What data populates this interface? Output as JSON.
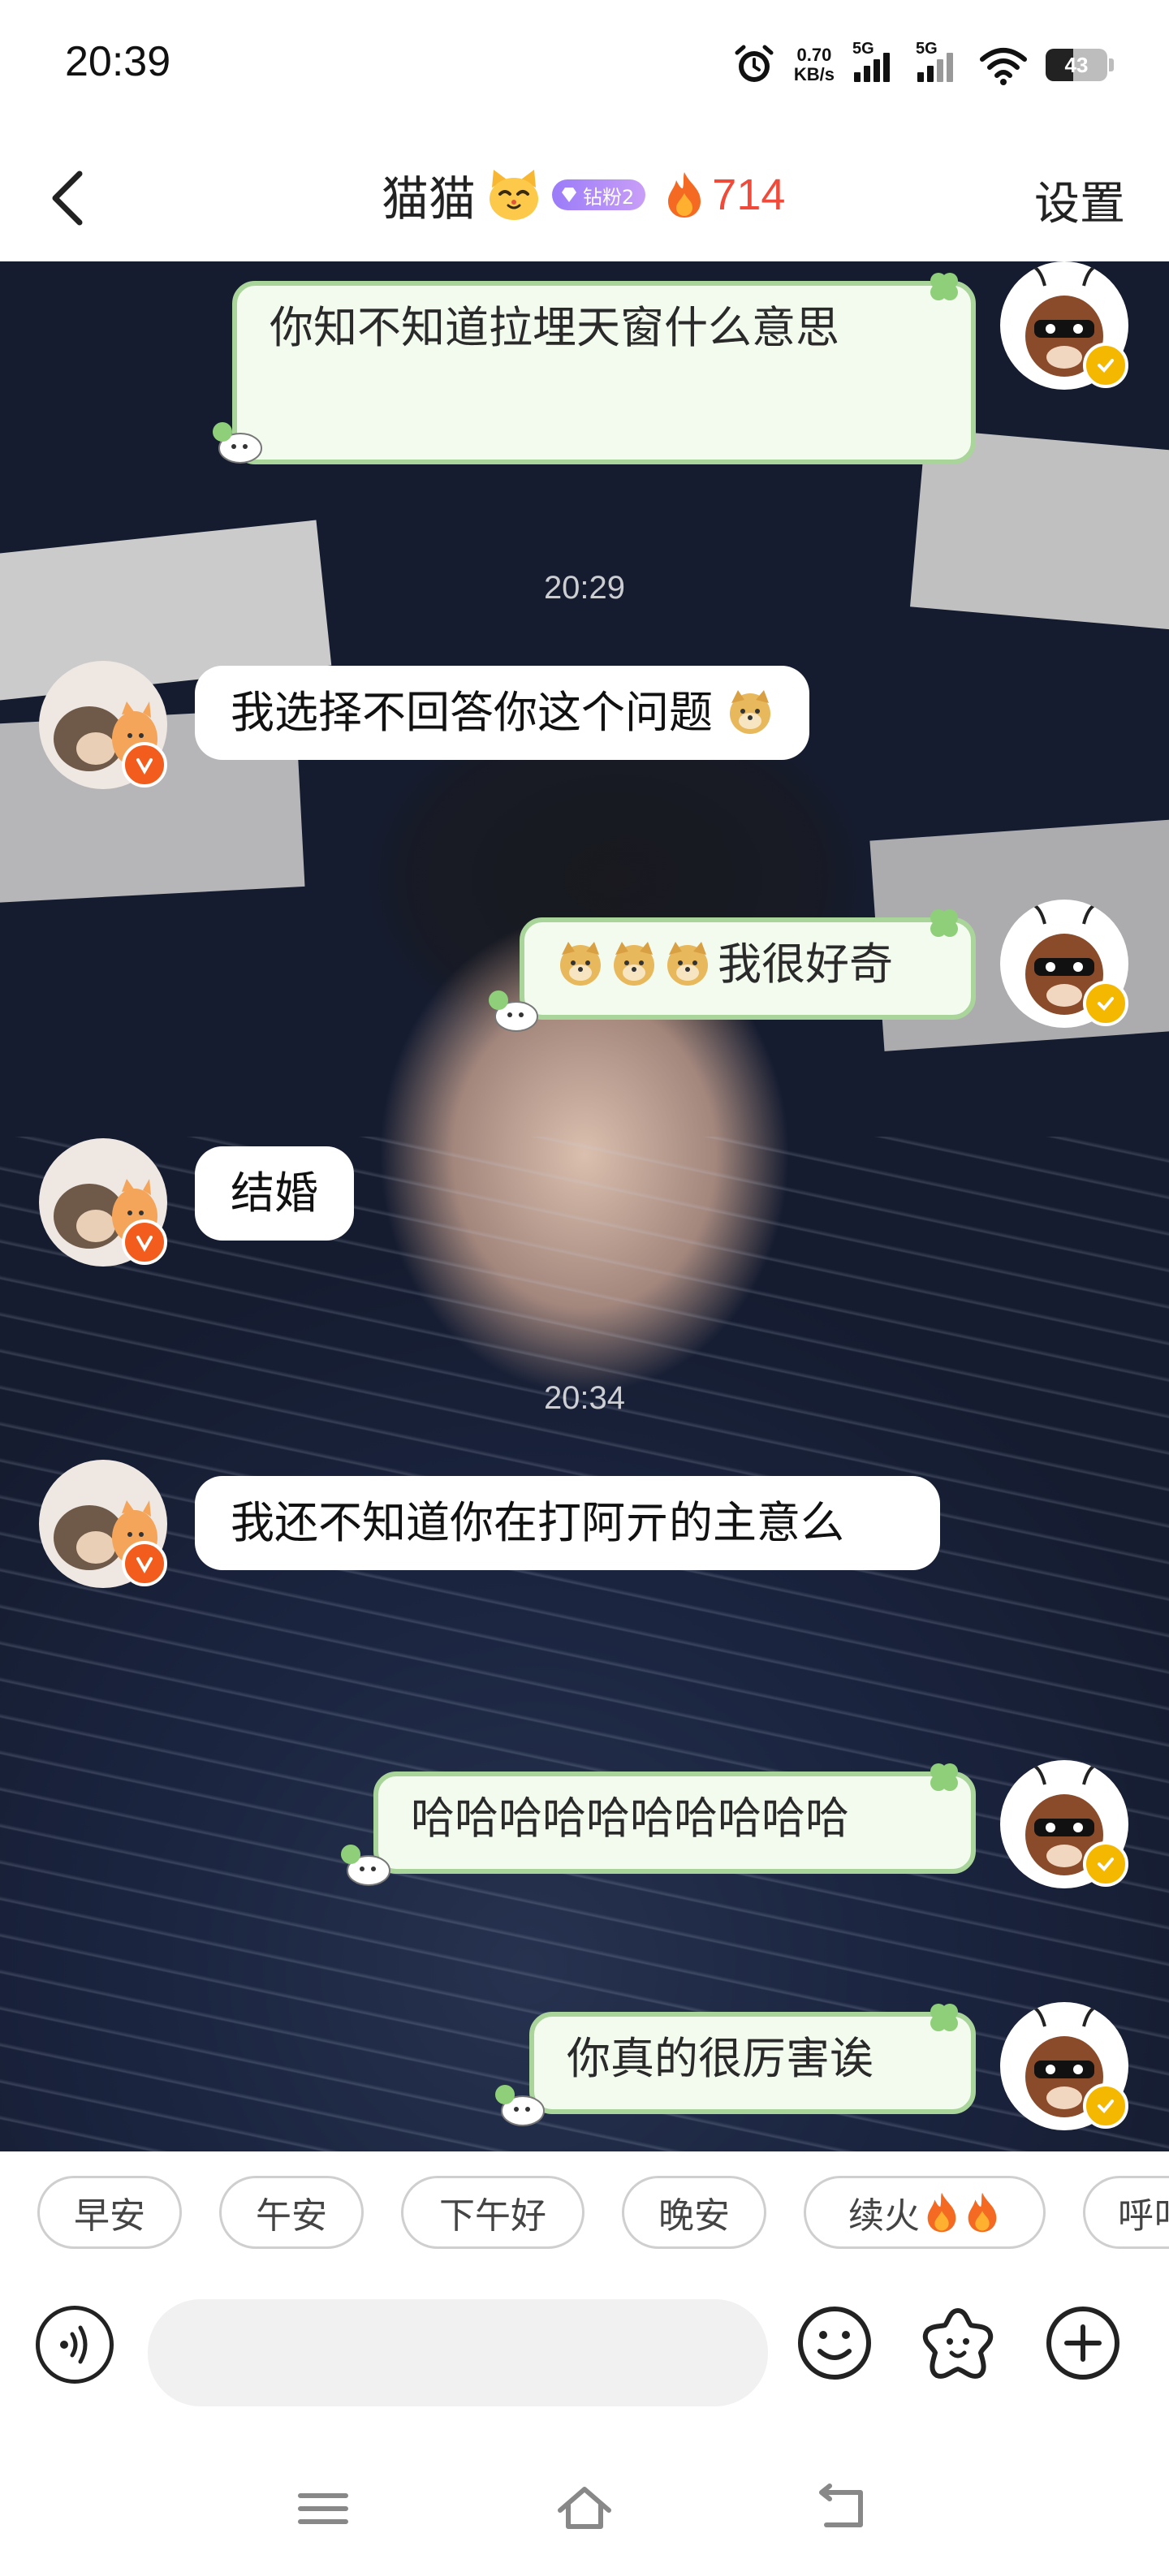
{
  "status_bar": {
    "time": "20:39",
    "net_speed_value": "0.70",
    "net_speed_unit": "KB/s",
    "signal1_label": "5G",
    "signal2_label": "5G",
    "battery": "43"
  },
  "header": {
    "title": "猫猫",
    "badge_label": "钻粉2",
    "streak": "714",
    "settings_label": "设置"
  },
  "messages": [
    {
      "side": "out",
      "text": "你知不知道拉埋天窗什么意思"
    },
    {
      "type": "time",
      "text": "20:29"
    },
    {
      "side": "in",
      "text": "我选择不回答你这个问题"
    },
    {
      "side": "out",
      "text": "我很好奇"
    },
    {
      "side": "in",
      "text": "结婚"
    },
    {
      "type": "time",
      "text": "20:34"
    },
    {
      "side": "in",
      "text": "我还不知道你在打阿亓的主意么"
    },
    {
      "side": "out",
      "text": "哈哈哈哈哈哈哈哈哈哈"
    },
    {
      "side": "out",
      "text": "你真的很厉害诶"
    }
  ],
  "quick_replies": [
    "早安",
    "午安",
    "下午好",
    "晚安",
    "续火",
    "呼叫"
  ],
  "colors": {
    "accent_green_border": "#a9d49a",
    "outgoing_bubble": "#f2fbee",
    "streak_red": "#f04a3a",
    "badge_purple": "#9b7cf8",
    "verified_orange": "#f25c1c",
    "verified_yellow": "#f5b800"
  }
}
